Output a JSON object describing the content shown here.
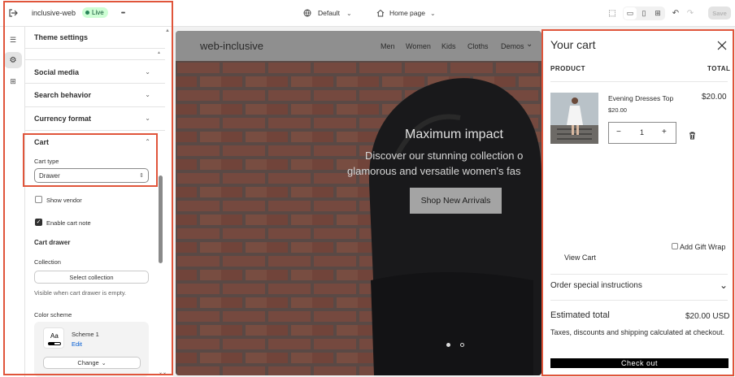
{
  "topbar": {
    "store_name": "inclusive-web",
    "live_badge": "Live",
    "more": "•••",
    "theme_select": "Default",
    "page_select": "Home page",
    "save": "Save"
  },
  "panel": {
    "title": "Theme settings",
    "sections": [
      "Social media",
      "Search behavior",
      "Currency format"
    ],
    "cart_section": {
      "title": "Cart",
      "cart_type_label": "Cart type",
      "cart_type_value": "Drawer",
      "show_vendor": "Show vendor",
      "enable_cart_note": "Enable cart note",
      "cart_drawer_heading": "Cart drawer",
      "collection_label": "Collection",
      "select_collection": "Select collection",
      "collection_help": "Visible when cart drawer is empty.",
      "color_scheme_label": "Color scheme",
      "scheme_swatch": "Aa",
      "scheme_name": "Scheme 1",
      "scheme_edit": "Edit",
      "change_button": "Change"
    },
    "checkboxes": {
      "show_vendor": false,
      "enable_cart_note": true
    }
  },
  "preview": {
    "brand": "web-inclusive",
    "nav": [
      "Men",
      "Women",
      "Kids",
      "Cloths",
      "Demos"
    ],
    "hero_title": "Maximum impact",
    "hero_line1": "Discover our stunning collection o",
    "hero_line2": "glamorous and versatile women's fas",
    "hero_button": "Shop New Arrivals"
  },
  "cart": {
    "title": "Your cart",
    "col_product": "PRODUCT",
    "col_total": "TOTAL",
    "item_name": "Evening Dresses Top",
    "item_price": "$20.00",
    "item_total": "$20.00",
    "quantity": "1",
    "qty_minus": "−",
    "qty_plus": "+",
    "gift_wrap": "Add Gift Wrap",
    "view_cart": "View Cart",
    "special_instructions": "Order special instructions",
    "estimated_label": "Estimated total",
    "estimated_value": "$20.00 USD",
    "tax_note": "Taxes, discounts and shipping calculated at checkout.",
    "checkout": "Check out"
  },
  "colors": {
    "accent_highlight": "#e0553b",
    "live_green": "#cdfed4",
    "checkout_bg": "#000000"
  }
}
